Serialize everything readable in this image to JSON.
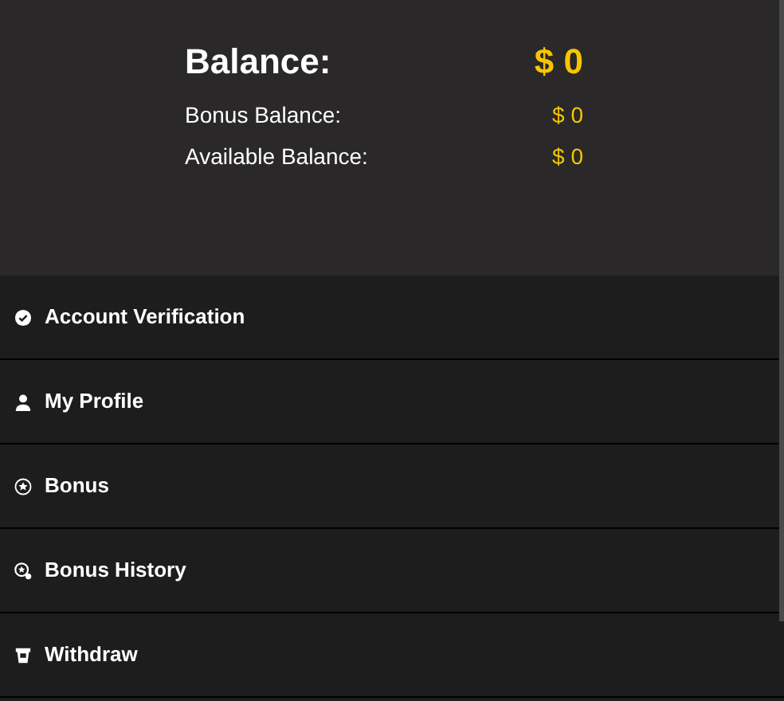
{
  "balance": {
    "label": "Balance:",
    "value": "$ 0"
  },
  "sub_balances": [
    {
      "label": "Bonus Balance:",
      "value": "$ 0"
    },
    {
      "label": "Available Balance:",
      "value": "$ 0"
    }
  ],
  "menu": [
    {
      "kind": "verify",
      "label": "Account Verification"
    },
    {
      "kind": "profile",
      "label": "My Profile"
    },
    {
      "kind": "bonus",
      "label": "Bonus"
    },
    {
      "kind": "history",
      "label": "Bonus History"
    },
    {
      "kind": "withdraw",
      "label": "Withdraw"
    }
  ]
}
